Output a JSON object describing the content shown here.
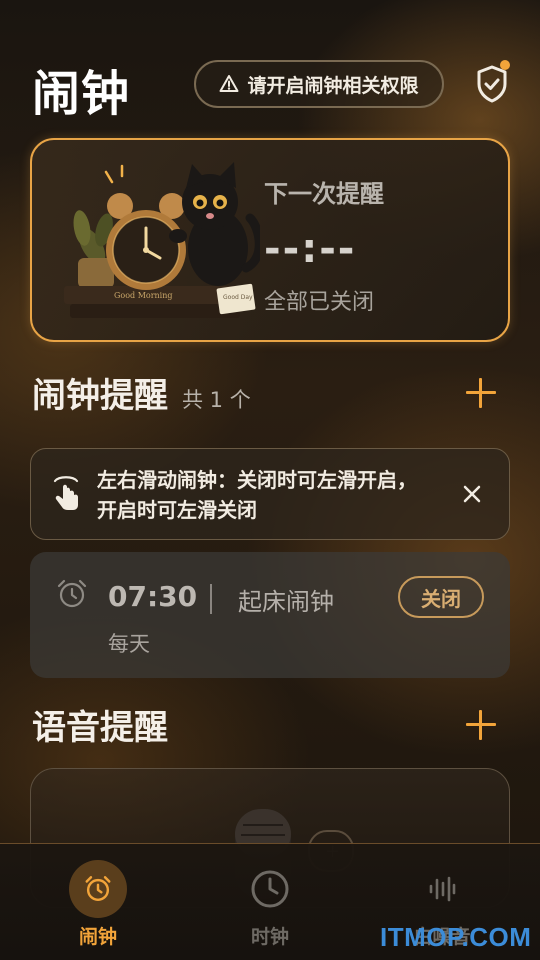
{
  "header": {
    "title": "闹钟",
    "permission_warning": "请开启闹钟相关权限"
  },
  "next_reminder": {
    "label": "下一次提醒",
    "time": "--:--",
    "status": "全部已关闭",
    "illustration_text": "Good Morning",
    "note_text": "Good Day"
  },
  "alarm_section": {
    "title": "闹钟提醒",
    "count": "共 1 个"
  },
  "tip": {
    "text": "左右滑动闹钟：关闭时可左滑开启，开启时可左滑关闭"
  },
  "alarms": [
    {
      "time": "07:30",
      "name": "起床闹钟",
      "repeat": "每天",
      "toggle_label": "关闭"
    }
  ],
  "voice_section": {
    "title": "语音提醒"
  },
  "tabs": [
    {
      "label": "闹钟",
      "icon": "alarm-clock-icon",
      "active": true
    },
    {
      "label": "时钟",
      "icon": "clock-icon",
      "active": false
    },
    {
      "label": "白噪音",
      "icon": "sound-wave-icon",
      "active": false
    }
  ],
  "watermark": "ITMOP.COM",
  "colors": {
    "accent": "#f2a43a",
    "card_border": "#e8a446",
    "background": "#1f1812"
  }
}
